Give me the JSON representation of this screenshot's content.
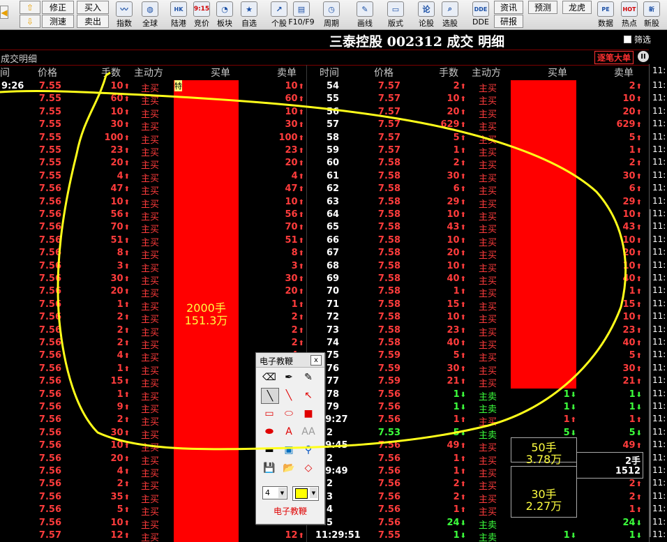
{
  "toolbar": {
    "square_buttons": [
      {
        "id": "correct",
        "label": "修正"
      },
      {
        "id": "buy",
        "label": "买入"
      },
      {
        "id": "test",
        "label": "测速"
      },
      {
        "id": "sell",
        "label": "卖出"
      }
    ],
    "icon_buttons": [
      {
        "id": "index",
        "label": "指数",
        "glyph": "〰",
        "icon": "chart-wave-icon"
      },
      {
        "id": "global",
        "label": "全球",
        "glyph": "◍",
        "icon": "globe-icon"
      },
      {
        "id": "hk",
        "label": "陆港",
        "glyph": "HK",
        "icon": "hk-connect-icon"
      },
      {
        "id": "auction",
        "label": "竞价",
        "glyph": "9:15",
        "icon": "auction-clock-icon"
      },
      {
        "id": "sector",
        "label": "板块",
        "glyph": "◔",
        "icon": "pie-icon"
      },
      {
        "id": "watchlist",
        "label": "自选",
        "glyph": "★",
        "icon": "star-icon"
      },
      {
        "id": "stock",
        "label": "个股",
        "glyph": "↗",
        "icon": "stock-trend-icon"
      },
      {
        "id": "f10",
        "label": "F10/F9",
        "glyph": "▤",
        "icon": "f10-icon"
      },
      {
        "id": "period",
        "label": "周期",
        "glyph": "◷",
        "icon": "clock-icon"
      },
      {
        "id": "draw",
        "label": "画线",
        "glyph": "✎",
        "icon": "pencil-icon"
      },
      {
        "id": "layout",
        "label": "版式",
        "glyph": "▭",
        "icon": "layout-icon"
      },
      {
        "id": "forum",
        "label": "论股",
        "glyph": "论",
        "icon": "forum-icon"
      },
      {
        "id": "pick",
        "label": "选股",
        "glyph": "⌕",
        "icon": "stock-picker-icon"
      },
      {
        "id": "dde",
        "label": "DDE",
        "glyph": "DDE",
        "icon": "dde-icon"
      }
    ],
    "text_buttons": [
      {
        "id": "info",
        "label": "资讯"
      },
      {
        "id": "forecast",
        "label": "预测"
      },
      {
        "id": "dragon",
        "label": "龙虎"
      },
      {
        "id": "research",
        "label": "研报"
      }
    ],
    "right_icons": [
      {
        "id": "data",
        "label": "数据",
        "glyph": "PE",
        "icon": "pe-data-icon"
      },
      {
        "id": "hot",
        "label": "热点",
        "glyph": "HOT",
        "icon": "hot-icon"
      },
      {
        "id": "ipo",
        "label": "新股",
        "glyph": "新",
        "icon": "new-stock-icon"
      }
    ]
  },
  "title": "三泰控股 002312 成交 明细",
  "filter_label": "筛选",
  "subtitle": "成交明细",
  "big_order_button": "逐笔大单",
  "pause_glyph": "II",
  "columns_left": [
    "间",
    "价格",
    "手数",
    "主动方",
    "买单",
    "卖单"
  ],
  "columns_right": [
    "时间",
    "价格",
    "手数",
    "主动方",
    "买单",
    "卖单"
  ],
  "left_rows": [
    {
      "t": "9:26",
      "p": "7.55",
      "v": "10",
      "s": "主买",
      "sell": "10"
    },
    {
      "t": "",
      "p": "7.55",
      "v": "60",
      "s": "主买",
      "sell": "60"
    },
    {
      "t": "",
      "p": "7.55",
      "v": "10",
      "s": "主买",
      "sell": "10"
    },
    {
      "t": "",
      "p": "7.55",
      "v": "30",
      "s": "主买",
      "sell": "30"
    },
    {
      "t": "",
      "p": "7.55",
      "v": "100",
      "s": "主买",
      "sell": "100"
    },
    {
      "t": "",
      "p": "7.55",
      "v": "23",
      "s": "主买",
      "sell": "23"
    },
    {
      "t": "",
      "p": "7.55",
      "v": "20",
      "s": "主买",
      "sell": "20"
    },
    {
      "t": "",
      "p": "7.55",
      "v": "4",
      "s": "主买",
      "sell": "4"
    },
    {
      "t": "",
      "p": "7.56",
      "v": "47",
      "s": "主买",
      "sell": "47"
    },
    {
      "t": "",
      "p": "7.56",
      "v": "10",
      "s": "主买",
      "sell": "10"
    },
    {
      "t": "",
      "p": "7.56",
      "v": "56",
      "s": "主买",
      "sell": "56"
    },
    {
      "t": "",
      "p": "7.56",
      "v": "70",
      "s": "主买",
      "sell": "70"
    },
    {
      "t": "",
      "p": "7.56",
      "v": "51",
      "s": "主买",
      "sell": "51"
    },
    {
      "t": "",
      "p": "7.56",
      "v": "8",
      "s": "主买",
      "sell": "8"
    },
    {
      "t": "",
      "p": "7.56",
      "v": "3",
      "s": "主买",
      "sell": "3"
    },
    {
      "t": "",
      "p": "7.56",
      "v": "30",
      "s": "主买",
      "sell": "30"
    },
    {
      "t": "",
      "p": "7.56",
      "v": "20",
      "s": "主买",
      "sell": "20"
    },
    {
      "t": "",
      "p": "7.56",
      "v": "1",
      "s": "主买",
      "sell": "1"
    },
    {
      "t": "",
      "p": "7.56",
      "v": "2",
      "s": "主买",
      "sell": "2"
    },
    {
      "t": "",
      "p": "7.56",
      "v": "2",
      "s": "主买",
      "sell": "2"
    },
    {
      "t": "",
      "p": "7.56",
      "v": "2",
      "s": "主买",
      "sell": "2"
    },
    {
      "t": "",
      "p": "7.56",
      "v": "4",
      "s": "主买",
      "sell": "4"
    },
    {
      "t": "",
      "p": "7.56",
      "v": "1",
      "s": "主买",
      "sell": "1"
    },
    {
      "t": "",
      "p": "7.56",
      "v": "15",
      "s": "主买",
      "sell": ""
    },
    {
      "t": "",
      "p": "7.56",
      "v": "1",
      "s": "主买",
      "sell": ""
    },
    {
      "t": "",
      "p": "7.56",
      "v": "9",
      "s": "主买",
      "sell": ""
    },
    {
      "t": "",
      "p": "7.56",
      "v": "2",
      "s": "主买",
      "sell": ""
    },
    {
      "t": "",
      "p": "7.56",
      "v": "30",
      "s": "主买",
      "sell": ""
    },
    {
      "t": "",
      "p": "7.56",
      "v": "10",
      "s": "主买",
      "sell": ""
    },
    {
      "t": "",
      "p": "7.56",
      "v": "20",
      "s": "主买",
      "sell": ""
    },
    {
      "t": "",
      "p": "7.56",
      "v": "4",
      "s": "主买",
      "sell": ""
    },
    {
      "t": "",
      "p": "7.56",
      "v": "2",
      "s": "主买",
      "sell": ""
    },
    {
      "t": "",
      "p": "7.56",
      "v": "35",
      "s": "主买",
      "sell": ""
    },
    {
      "t": "",
      "p": "7.56",
      "v": "5",
      "s": "主买",
      "sell": ""
    },
    {
      "t": "",
      "p": "7.56",
      "v": "10",
      "s": "主买",
      "sell": ""
    },
    {
      "t": "",
      "p": "7.57",
      "v": "12",
      "s": "主买",
      "sell": "12"
    }
  ],
  "left_block_label": [
    "2000手",
    "151.3万"
  ],
  "left_block_marker": "特",
  "right_rows": [
    {
      "t": "54",
      "p": "7.57",
      "v": "2",
      "s": "主买",
      "dir": "up",
      "pc": "red",
      "sell": "2"
    },
    {
      "t": "55",
      "p": "7.57",
      "v": "10",
      "s": "主买",
      "dir": "up",
      "pc": "red",
      "sell": "10"
    },
    {
      "t": "56",
      "p": "7.57",
      "v": "20",
      "s": "主买",
      "dir": "up",
      "pc": "red",
      "sell": "20"
    },
    {
      "t": "57",
      "p": "7.57",
      "v": "629",
      "s": "主买",
      "dir": "up",
      "pc": "red",
      "sell": "629"
    },
    {
      "t": "58",
      "p": "7.57",
      "v": "5",
      "s": "主买",
      "dir": "up",
      "pc": "red",
      "sell": "5"
    },
    {
      "t": "59",
      "p": "7.57",
      "v": "1",
      "s": "主买",
      "dir": "up",
      "pc": "red",
      "sell": "1"
    },
    {
      "t": "60",
      "p": "7.58",
      "v": "2",
      "s": "主买",
      "dir": "up",
      "pc": "red",
      "sell": "2"
    },
    {
      "t": "61",
      "p": "7.58",
      "v": "30",
      "s": "主买",
      "dir": "up",
      "pc": "red",
      "sell": "30"
    },
    {
      "t": "62",
      "p": "7.58",
      "v": "6",
      "s": "主买",
      "dir": "up",
      "pc": "red",
      "sell": "6"
    },
    {
      "t": "63",
      "p": "7.58",
      "v": "29",
      "s": "主买",
      "dir": "up",
      "pc": "red",
      "sell": "29"
    },
    {
      "t": "64",
      "p": "7.58",
      "v": "10",
      "s": "主买",
      "dir": "up",
      "pc": "red",
      "sell": "10"
    },
    {
      "t": "65",
      "p": "7.58",
      "v": "43",
      "s": "主买",
      "dir": "up",
      "pc": "red",
      "sell": "43"
    },
    {
      "t": "66",
      "p": "7.58",
      "v": "10",
      "s": "主买",
      "dir": "up",
      "pc": "red",
      "sell": "10"
    },
    {
      "t": "67",
      "p": "7.58",
      "v": "20",
      "s": "主买",
      "dir": "up",
      "pc": "red",
      "sell": "20"
    },
    {
      "t": "68",
      "p": "7.58",
      "v": "10",
      "s": "主买",
      "dir": "up",
      "pc": "red",
      "sell": "10"
    },
    {
      "t": "69",
      "p": "7.58",
      "v": "40",
      "s": "主买",
      "dir": "up",
      "pc": "red",
      "sell": "40"
    },
    {
      "t": "70",
      "p": "7.58",
      "v": "1",
      "s": "主买",
      "dir": "up",
      "pc": "red",
      "sell": "1"
    },
    {
      "t": "71",
      "p": "7.58",
      "v": "15",
      "s": "主买",
      "dir": "up",
      "pc": "red",
      "sell": "15"
    },
    {
      "t": "72",
      "p": "7.58",
      "v": "10",
      "s": "主买",
      "dir": "up",
      "pc": "red",
      "sell": "10"
    },
    {
      "t": "73",
      "p": "7.58",
      "v": "23",
      "s": "主买",
      "dir": "up",
      "pc": "red",
      "sell": "23"
    },
    {
      "t": "74",
      "p": "7.58",
      "v": "40",
      "s": "主买",
      "dir": "up",
      "pc": "red",
      "sell": "40"
    },
    {
      "t": "75",
      "p": "7.59",
      "v": "5",
      "s": "主买",
      "dir": "up",
      "pc": "red",
      "sell": "5"
    },
    {
      "t": "76",
      "p": "7.59",
      "v": "30",
      "s": "主买",
      "dir": "up",
      "pc": "red",
      "sell": "30"
    },
    {
      "t": "77",
      "p": "7.59",
      "v": "21",
      "s": "主买",
      "dir": "up",
      "pc": "red",
      "sell": "21"
    },
    {
      "t": "78",
      "p": "7.56",
      "v": "1",
      "s": "主卖",
      "dir": "dn",
      "pc": "red",
      "buy": "1",
      "sell": "1"
    },
    {
      "t": "79",
      "p": "7.56",
      "v": "1",
      "s": "主卖",
      "dir": "dn",
      "pc": "red",
      "buy": "1",
      "sell": "1"
    },
    {
      "t": ":29:27",
      "p": "7.56",
      "v": "1",
      "s": "主买",
      "dir": "up",
      "pc": "red",
      "buy": "1",
      "sell": "1"
    },
    {
      "t": "2",
      "p": "7.53",
      "v": "5",
      "s": "主卖",
      "dir": "dn",
      "pc": "green",
      "buy": "5",
      "sell": "5"
    },
    {
      "t": ":29:45",
      "p": "7.56",
      "v": "49",
      "s": "主买",
      "dir": "up",
      "pc": "red",
      "sell": "49"
    },
    {
      "t": "2",
      "p": "7.56",
      "v": "1",
      "s": "主买",
      "dir": "up",
      "pc": "red",
      "sell": "2手"
    },
    {
      "t": ":29:49",
      "p": "7.56",
      "v": "1",
      "s": "主买",
      "dir": "up",
      "pc": "red",
      "sell": "1512"
    },
    {
      "t": "2",
      "p": "7.56",
      "v": "2",
      "s": "主买",
      "dir": "up",
      "pc": "red",
      "sell": "2"
    },
    {
      "t": "3",
      "p": "7.56",
      "v": "2",
      "s": "主买",
      "dir": "up",
      "pc": "red",
      "sell": "2"
    },
    {
      "t": "4",
      "p": "7.56",
      "v": "1",
      "s": "主买",
      "dir": "up",
      "pc": "red",
      "sell": "1"
    },
    {
      "t": "5",
      "p": "7.56",
      "v": "24",
      "s": "主卖",
      "dir": "dn",
      "pc": "red",
      "sell": "24"
    },
    {
      "t": "11:29:51",
      "p": "7.55",
      "v": "1",
      "s": "主卖",
      "dir": "dn",
      "pc": "red",
      "buy": "1",
      "sell": "1"
    }
  ],
  "right_boxes": [
    {
      "l1": "50手",
      "l2": "3.78万"
    },
    {
      "l1": "30手",
      "l2": "2.27万"
    }
  ],
  "right_strip_prefix": "11:",
  "pen_panel": {
    "title": "电子教鞭",
    "close_glyph": "x",
    "size_value": "4",
    "label": "电子教鞭",
    "tools": [
      {
        "name": "eraser-icon",
        "glyph": "⌫"
      },
      {
        "name": "pen-icon",
        "glyph": "✒"
      },
      {
        "name": "marker-icon",
        "glyph": "✎"
      },
      {
        "name": "pointer-icon",
        "glyph": "╲"
      },
      {
        "name": "line-icon",
        "glyph": "╲"
      },
      {
        "name": "arrow-icon",
        "glyph": "↖"
      },
      {
        "name": "rectangle-icon",
        "glyph": "▭"
      },
      {
        "name": "ellipse-icon",
        "glyph": "⬭"
      },
      {
        "name": "filled-rectangle-icon",
        "glyph": "■"
      },
      {
        "name": "filled-ellipse-icon",
        "glyph": "⬬"
      },
      {
        "name": "text-icon",
        "glyph": "A"
      },
      {
        "name": "text-size-icon",
        "glyph": "AA"
      },
      {
        "name": "line-width-icon",
        "glyph": "▬"
      },
      {
        "name": "screenshot-icon",
        "glyph": "▣"
      },
      {
        "name": "magnifier-icon",
        "glyph": "⚲"
      },
      {
        "name": "save-icon",
        "glyph": "💾"
      },
      {
        "name": "open-folder-icon",
        "glyph": "📂"
      },
      {
        "name": "clear-icon",
        "glyph": "◇"
      }
    ]
  },
  "colors": {
    "up": "#ff3c3c",
    "down": "#3cff3c",
    "highlight": "#ffff00",
    "block": "#ff0000"
  }
}
